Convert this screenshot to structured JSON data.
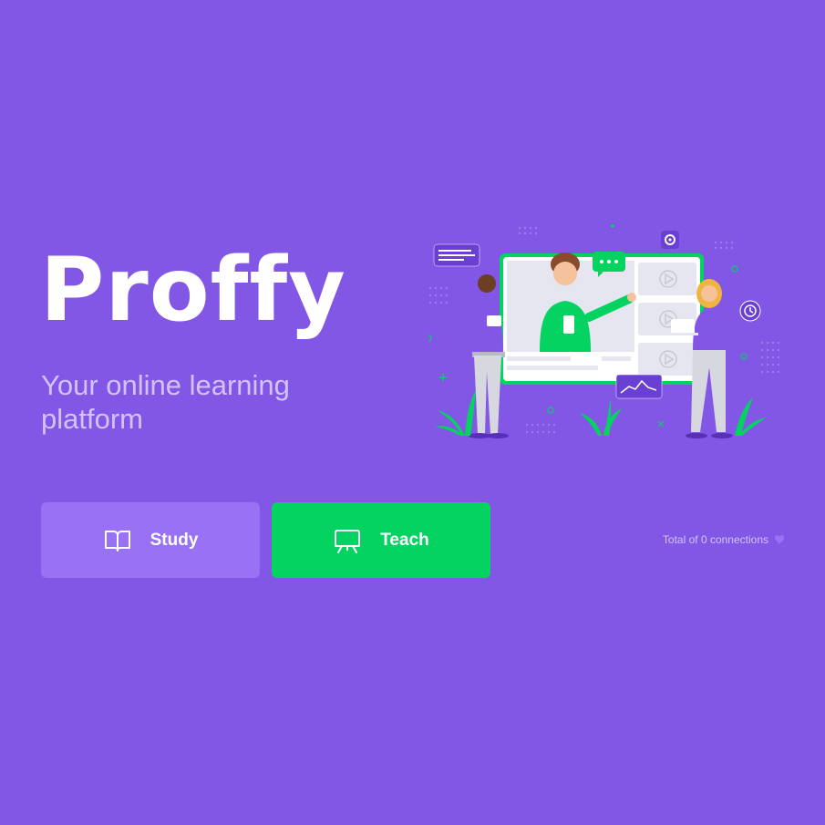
{
  "brand": {
    "name": "Proffy",
    "tagline": "Your online learning platform"
  },
  "actions": {
    "study": {
      "label": "Study",
      "icon": "book-open-icon"
    },
    "teach": {
      "label": "Teach",
      "icon": "presentation-board-icon"
    }
  },
  "footer": {
    "connections_text": "Total of 0 connections",
    "icon": "heart-icon"
  },
  "colors": {
    "background": "#8257e5",
    "study_button": "#9871f5",
    "teach_button": "#04d361",
    "tagline": "#d4c2ff",
    "accent_green": "#04d361"
  }
}
